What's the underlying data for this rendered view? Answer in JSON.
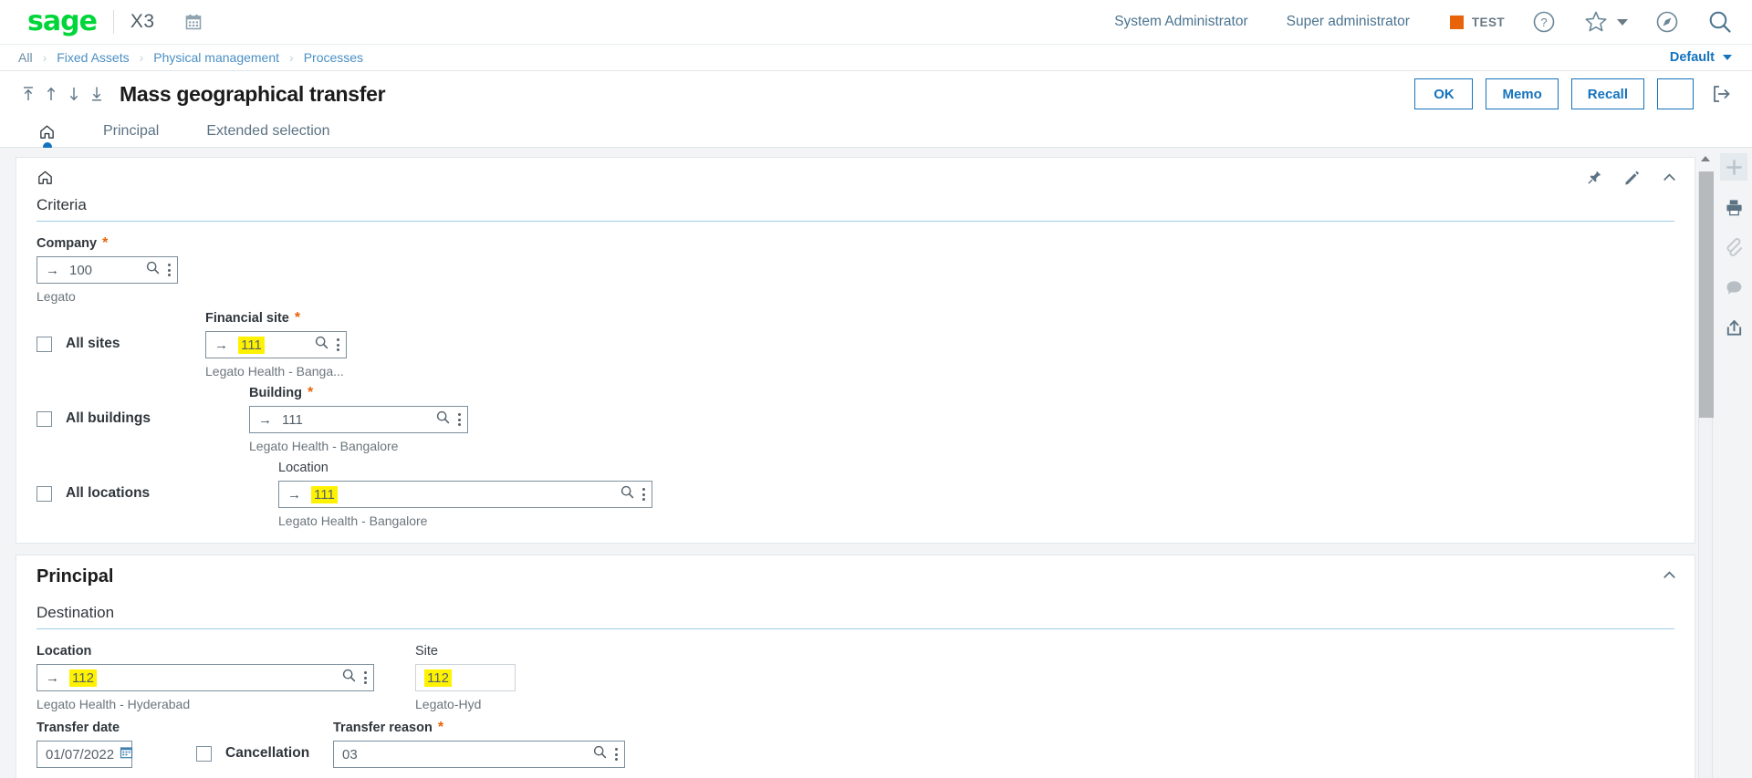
{
  "topbar": {
    "logo": "sage",
    "product": "X3",
    "calendar_icon": "calendar-icon",
    "links": [
      "System Administrator",
      "Super administrator"
    ],
    "environment": {
      "label": "TEST",
      "color": "#E8630A"
    },
    "icons": [
      "help-icon",
      "favorites-star-icon",
      "chevron-down-icon",
      "compass-icon",
      "search-icon"
    ]
  },
  "breadcrumb": {
    "items": [
      "All",
      "Fixed Assets",
      "Physical management",
      "Processes"
    ],
    "separator": "›",
    "selector": "Default"
  },
  "title_row": {
    "nav_icons": [
      "first-record-icon",
      "previous-record-icon",
      "next-record-icon",
      "last-record-icon"
    ],
    "title": "Mass geographical transfer",
    "buttons": [
      "OK",
      "Memo",
      "Recall"
    ],
    "more_icon": "kebab-menu-icon",
    "exit_icon": "exit-icon",
    "accent": "#1573be"
  },
  "tabs": {
    "home_icon": "home-icon",
    "items": [
      "Principal",
      "Extended selection"
    ],
    "active": "home"
  },
  "criteria_card": {
    "home_icon": "home-icon",
    "section_title": "Criteria",
    "icons": [
      "pin-icon",
      "pencil-icon",
      "chevron-up-icon"
    ],
    "company": {
      "label": "Company",
      "required": "*",
      "value": "100",
      "helper": "Legato",
      "search_icon": "search-icon",
      "menu_icon": "kebab-menu-icon",
      "goto_icon": "arrow-right-icon"
    },
    "rows": [
      {
        "checkbox_label": "All sites",
        "checked": false,
        "label": "Financial site",
        "required": "*",
        "value": "111",
        "highlighted": true,
        "helper": "Legato Health - Banga..."
      },
      {
        "checkbox_label": "All buildings",
        "checked": false,
        "label": "Building",
        "required": "*",
        "value": "111",
        "highlighted": false,
        "helper": "Legato Health - Bangalore"
      },
      {
        "checkbox_label": "All locations",
        "checked": false,
        "label": "Location",
        "required": "",
        "value": "111",
        "highlighted": true,
        "helper": "Legato Health - Bangalore"
      }
    ]
  },
  "principal_card": {
    "block_title": "Principal",
    "collapse_icon": "chevron-up-icon",
    "section_title": "Destination",
    "location": {
      "label": "Location",
      "value": "112",
      "highlighted": true,
      "helper": "Legato Health - Hyderabad"
    },
    "site": {
      "label": "Site",
      "value": "112",
      "highlighted": true,
      "helper": "Legato-Hyd"
    },
    "transfer_date": {
      "label": "Transfer date",
      "value": "01/07/2022",
      "calendar_icon": "calendar-icon"
    },
    "cancellation": {
      "label": "Cancellation",
      "checked": false
    },
    "transfer_reason": {
      "label": "Transfer reason",
      "required": "*",
      "value": "03",
      "search_icon": "search-icon",
      "menu_icon": "kebab-menu-icon"
    }
  },
  "right_rail": {
    "icons": [
      "add-plus-icon",
      "print-icon",
      "attachment-icon",
      "comment-icon",
      "share-upload-icon"
    ],
    "scroll_up_icon": "scroll-up-arrow-icon"
  },
  "colors": {
    "accent": "#1573be",
    "brand_green": "#00D639",
    "required_orange": "#E8630A",
    "highlight_yellow": "#FFF200"
  }
}
